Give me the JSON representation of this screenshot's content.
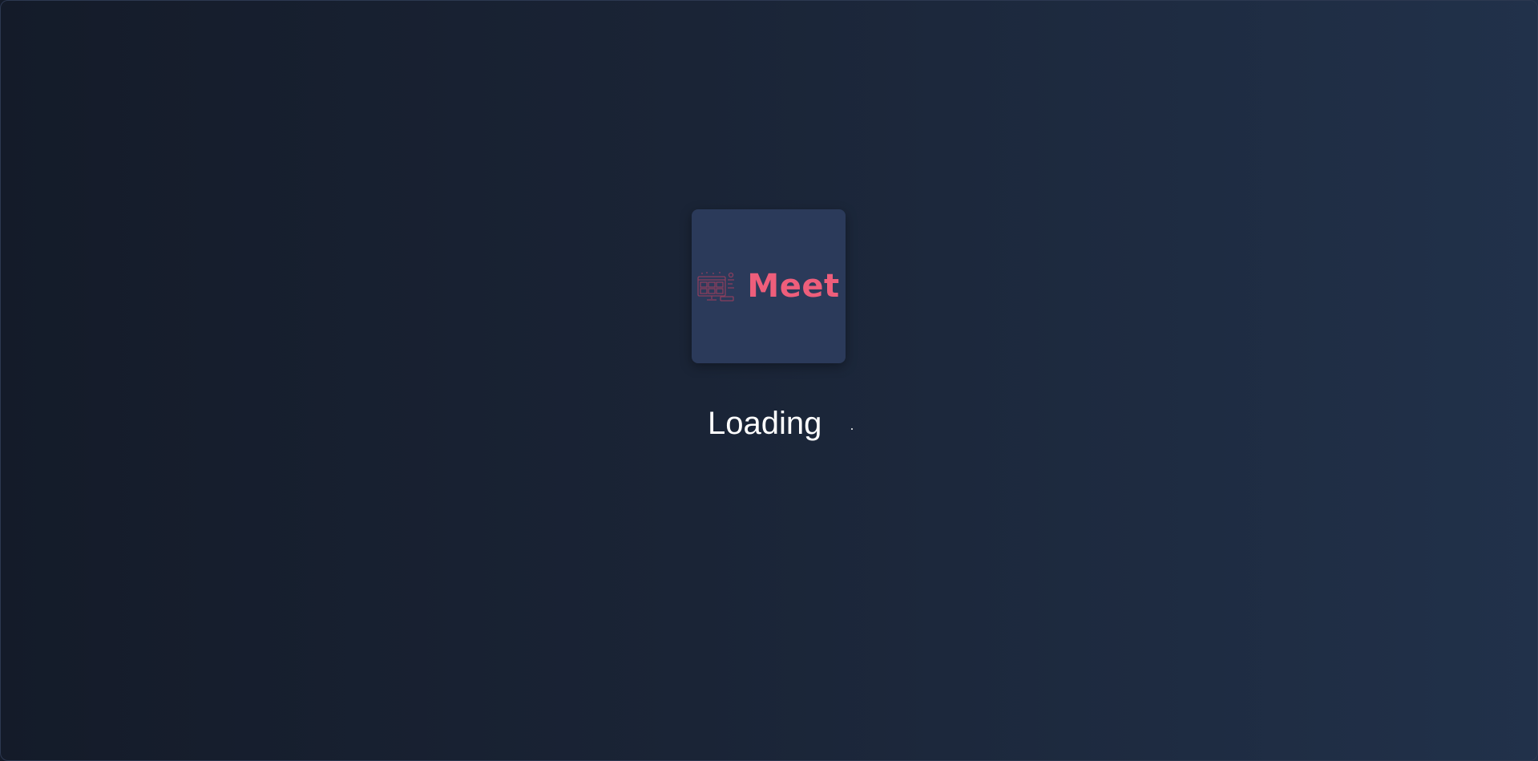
{
  "loader": {
    "logo": {
      "wordmark": "Meet",
      "icon": "video-conference-screen-icon",
      "accent_color": "#ee5e7b",
      "card_color": "#2b3a5a"
    },
    "status_text": "Loading",
    "background": {
      "gradient_start": "#141b29",
      "gradient_end": "#21314a"
    }
  }
}
